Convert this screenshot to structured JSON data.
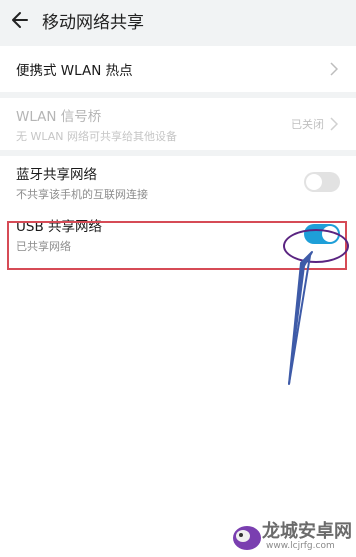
{
  "header": {
    "title": "移动网络共享"
  },
  "rows": {
    "hotspot": {
      "label": "便携式 WLAN 热点"
    },
    "bridge": {
      "label": "WLAN 信号桥",
      "subtitle": "无 WLAN 网络可共享给其他设备",
      "status": "已关闭"
    },
    "bluetooth": {
      "label": "蓝牙共享网络",
      "subtitle": "不共享该手机的互联网连接",
      "state": "off"
    },
    "usb": {
      "label": "USB 共享网络",
      "subtitle": "已共享网络",
      "state": "on"
    }
  },
  "watermark": {
    "name": "龙城安卓网",
    "url": "www.lcjrfg.com"
  },
  "colors": {
    "toggle_on": "#1e9fd8",
    "highlight_box": "#d64b56",
    "annotation": "#5a2481",
    "arrow": "#3e5ba8"
  },
  "icons": {
    "back": "arrow-left-icon",
    "chevron": "chevron-right-icon"
  }
}
